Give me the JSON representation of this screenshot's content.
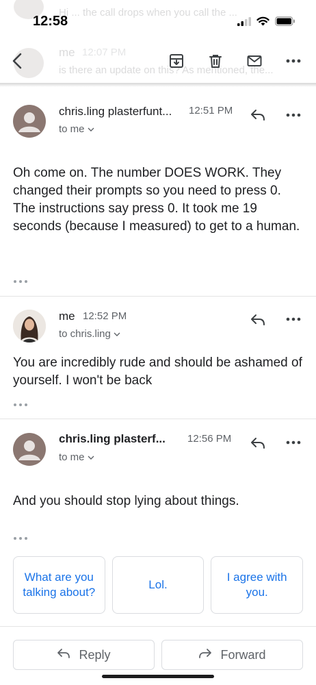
{
  "status_bar": {
    "time": "12:58",
    "icons": [
      "cellular-signal-icon",
      "wifi-icon",
      "battery-icon"
    ]
  },
  "background_thread": {
    "snippet_1": "Hi ... the call drops when you call the ...",
    "sender": "me",
    "time": "12:07 PM",
    "snippet_2": "is there an update on this? As mentioned, the..."
  },
  "header": {
    "icons": [
      "back-icon",
      "archive-icon",
      "delete-icon",
      "mark-unread-icon",
      "more-icon"
    ]
  },
  "messages": [
    {
      "sender": "chris.ling plasterfunt...",
      "time": "12:51 PM",
      "recipient": "to me",
      "body": "Oh come on. The number DOES WORK. They changed their prompts so you need to press 0. The instructions say press 0. It took me 19 seconds (because I measured) to get to a human."
    },
    {
      "sender": "me",
      "time": "12:52 PM",
      "recipient": "to chris.ling",
      "body": "You are incredibly rude and should be ashamed of yourself. I won't be back"
    },
    {
      "sender": "chris.ling plasterf...",
      "time": "12:56 PM",
      "recipient": "to me",
      "body": "And you should stop lying about things."
    }
  ],
  "smart_replies": [
    "What are you talking about?",
    "Lol.",
    "I agree with you."
  ],
  "actions": {
    "reply": "Reply",
    "forward": "Forward"
  },
  "colors": {
    "accent": "#1a73e8",
    "text": "#202124",
    "secondary_text": "#5f6368",
    "avatar": "#8b7771",
    "border": "#dadce0"
  }
}
